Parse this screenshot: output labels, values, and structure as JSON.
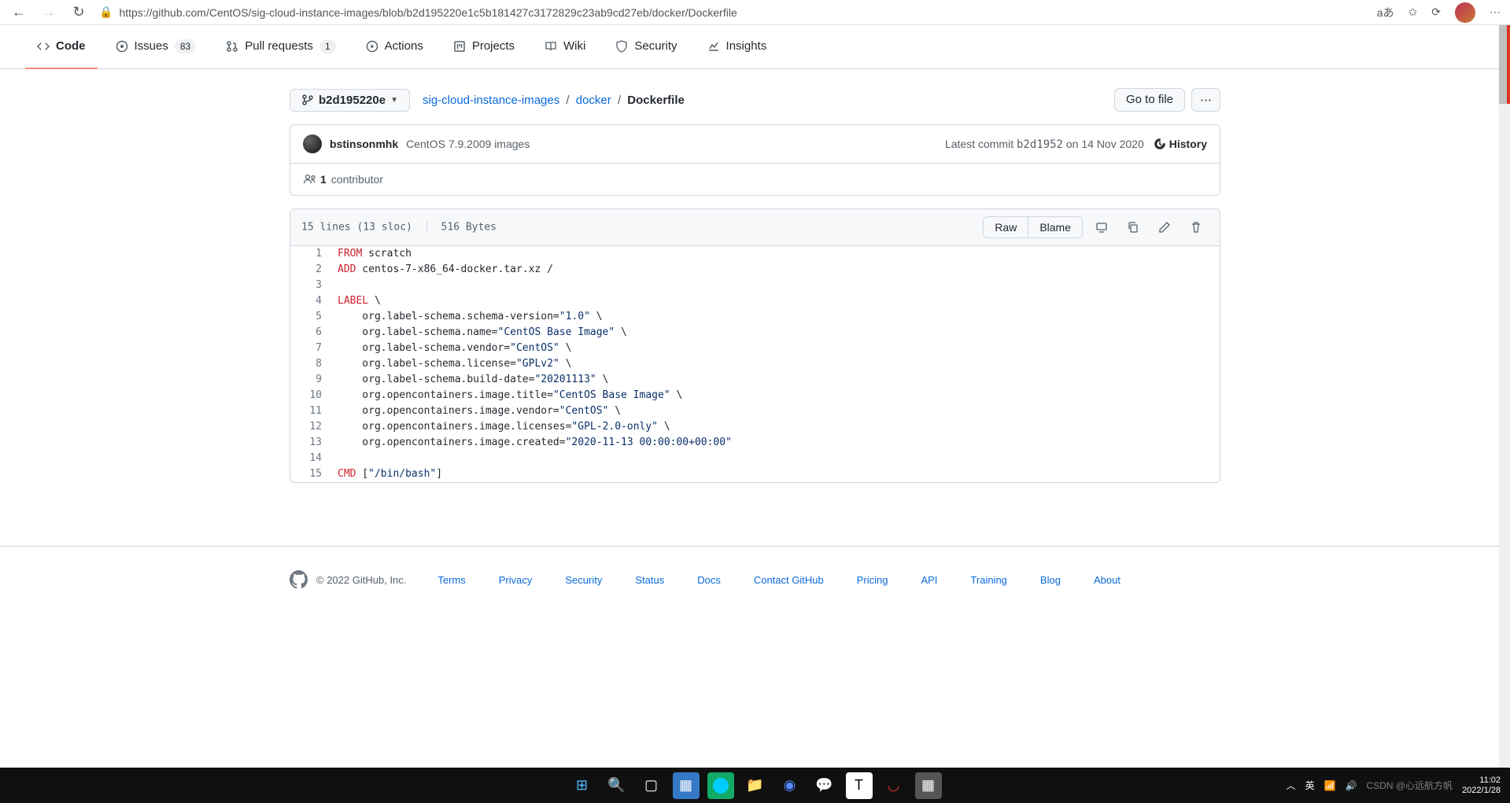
{
  "browser": {
    "url": "https://github.com/CentOS/sig-cloud-instance-images/blob/b2d195220e1c5b181427c3172829c23ab9cd27eb/docker/Dockerfile"
  },
  "repo_tabs": {
    "code": "Code",
    "issues": "Issues",
    "issues_count": "83",
    "pulls": "Pull requests",
    "pulls_count": "1",
    "actions": "Actions",
    "projects": "Projects",
    "wiki": "Wiki",
    "security": "Security",
    "insights": "Insights"
  },
  "file_nav": {
    "branch": "b2d195220e",
    "crumb_repo": "sig-cloud-instance-images",
    "crumb_dir": "docker",
    "crumb_file": "Dockerfile",
    "go_to_file": "Go to file"
  },
  "commit": {
    "author": "bstinsonmhk",
    "message": "CentOS 7.9.2009 images",
    "latest_pre": "Latest commit ",
    "sha": "b2d1952",
    "on": " on ",
    "date": "14 Nov 2020",
    "history": "History",
    "contrib_count": "1",
    "contrib_label": " contributor"
  },
  "file_header": {
    "lines": "15 lines (13 sloc)",
    "bytes": "516 Bytes",
    "raw": "Raw",
    "blame": "Blame"
  },
  "code_lines": [
    {
      "n": "1",
      "segments": [
        {
          "t": "FROM",
          "c": "kw"
        },
        {
          "t": " scratch"
        }
      ]
    },
    {
      "n": "2",
      "segments": [
        {
          "t": "ADD",
          "c": "kw"
        },
        {
          "t": " centos-7-x86_64-docker.tar.xz /"
        }
      ]
    },
    {
      "n": "3",
      "segments": []
    },
    {
      "n": "4",
      "segments": [
        {
          "t": "LABEL",
          "c": "kw"
        },
        {
          "t": " \\"
        }
      ]
    },
    {
      "n": "5",
      "segments": [
        {
          "t": "    org.label-schema.schema-version="
        },
        {
          "t": "\"1.0\"",
          "c": "str"
        },
        {
          "t": " \\"
        }
      ]
    },
    {
      "n": "6",
      "segments": [
        {
          "t": "    org.label-schema.name="
        },
        {
          "t": "\"CentOS Base Image\"",
          "c": "str"
        },
        {
          "t": " \\"
        }
      ]
    },
    {
      "n": "7",
      "segments": [
        {
          "t": "    org.label-schema.vendor="
        },
        {
          "t": "\"CentOS\"",
          "c": "str"
        },
        {
          "t": " \\"
        }
      ]
    },
    {
      "n": "8",
      "segments": [
        {
          "t": "    org.label-schema.license="
        },
        {
          "t": "\"GPLv2\"",
          "c": "str"
        },
        {
          "t": " \\"
        }
      ]
    },
    {
      "n": "9",
      "segments": [
        {
          "t": "    org.label-schema.build-date="
        },
        {
          "t": "\"20201113\"",
          "c": "str"
        },
        {
          "t": " \\"
        }
      ]
    },
    {
      "n": "10",
      "segments": [
        {
          "t": "    org.opencontainers.image.title="
        },
        {
          "t": "\"CentOS Base Image\"",
          "c": "str"
        },
        {
          "t": " \\"
        }
      ]
    },
    {
      "n": "11",
      "segments": [
        {
          "t": "    org.opencontainers.image.vendor="
        },
        {
          "t": "\"CentOS\"",
          "c": "str"
        },
        {
          "t": " \\"
        }
      ]
    },
    {
      "n": "12",
      "segments": [
        {
          "t": "    org.opencontainers.image.licenses="
        },
        {
          "t": "\"GPL-2.0-only\"",
          "c": "str"
        },
        {
          "t": " \\"
        }
      ]
    },
    {
      "n": "13",
      "segments": [
        {
          "t": "    org.opencontainers.image.created="
        },
        {
          "t": "\"2020-11-13 00:00:00+00:00\"",
          "c": "str"
        }
      ]
    },
    {
      "n": "14",
      "segments": []
    },
    {
      "n": "15",
      "segments": [
        {
          "t": "CMD",
          "c": "kw"
        },
        {
          "t": " ["
        },
        {
          "t": "\"/bin/bash\"",
          "c": "str"
        },
        {
          "t": "]"
        }
      ]
    }
  ],
  "footer": {
    "copyright": "© 2022 GitHub, Inc.",
    "links": [
      "Terms",
      "Privacy",
      "Security",
      "Status",
      "Docs",
      "Contact GitHub",
      "Pricing",
      "API",
      "Training",
      "Blog",
      "About"
    ]
  },
  "taskbar": {
    "lang": "英",
    "time": "11:02",
    "date": "2022/1/28",
    "watermark": "CSDN @心远航方帆"
  }
}
